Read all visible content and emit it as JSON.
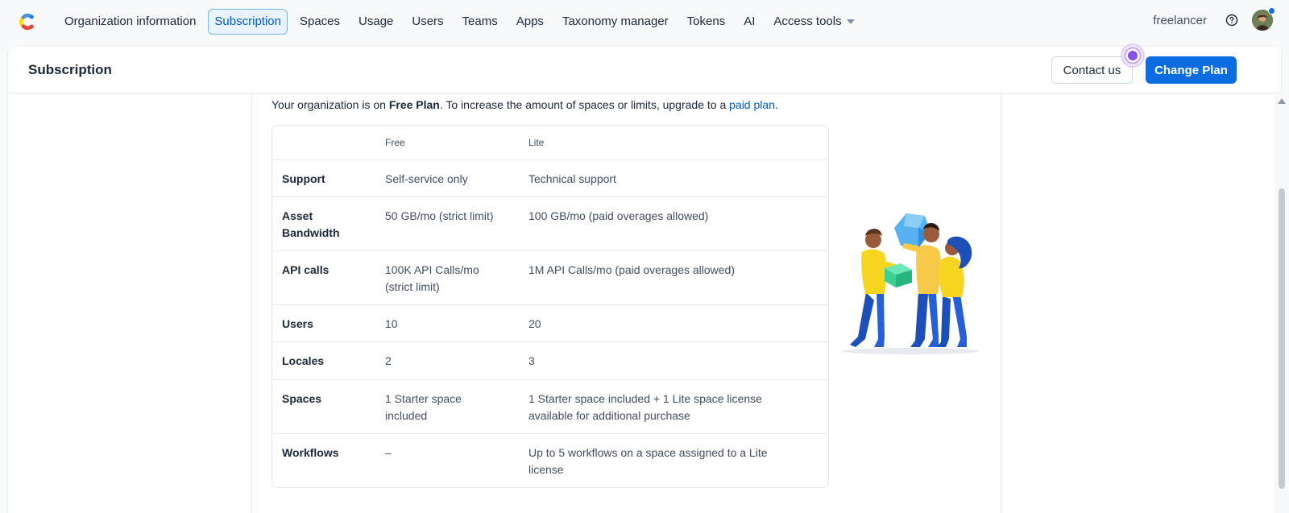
{
  "nav": {
    "items": [
      {
        "label": "Organization information",
        "active": false
      },
      {
        "label": "Subscription",
        "active": true
      },
      {
        "label": "Spaces",
        "active": false
      },
      {
        "label": "Usage",
        "active": false
      },
      {
        "label": "Users",
        "active": false
      },
      {
        "label": "Teams",
        "active": false
      },
      {
        "label": "Apps",
        "active": false
      },
      {
        "label": "Taxonomy manager",
        "active": false
      },
      {
        "label": "Tokens",
        "active": false
      },
      {
        "label": "AI",
        "active": false
      },
      {
        "label": "Access tools",
        "active": false,
        "has_dropdown": true
      }
    ],
    "username": "freelancer",
    "help_icon": "question-circle-icon",
    "avatar_icon": "user-avatar"
  },
  "header": {
    "title": "Subscription",
    "contact_label": "Contact us",
    "change_plan_label": "Change Plan"
  },
  "intro": {
    "prefix": "Your organization is on ",
    "plan": "Free Plan",
    "middle": ". To increase the amount of spaces or limits, upgrade to a ",
    "link": "paid plan",
    "suffix": "."
  },
  "table": {
    "columns": [
      "",
      "Free",
      "Lite"
    ],
    "rows": [
      {
        "feature": "Support",
        "free": "Self-service only",
        "lite": "Technical support"
      },
      {
        "feature": "Asset Bandwidth",
        "free": "50 GB/mo (strict limit)",
        "lite": "100 GB/mo (paid overages allowed)"
      },
      {
        "feature": "API calls",
        "free": "100K API Calls/mo (strict limit)",
        "lite": "1M API Calls/mo (paid overages allowed)"
      },
      {
        "feature": "Users",
        "free": "10",
        "lite": "20"
      },
      {
        "feature": "Locales",
        "free": "2",
        "lite": "3"
      },
      {
        "feature": "Spaces",
        "free": "1 Starter space included",
        "lite": "1 Starter space included + 1 Lite space license available for additional purchase"
      },
      {
        "feature": "Workflows",
        "free": "–",
        "lite": "Up to 5 workflows on a space assigned to a Lite license"
      }
    ]
  },
  "colors": {
    "accent": "#0b6de0",
    "link": "#0059c8",
    "beacon": "#8a4fe8"
  }
}
